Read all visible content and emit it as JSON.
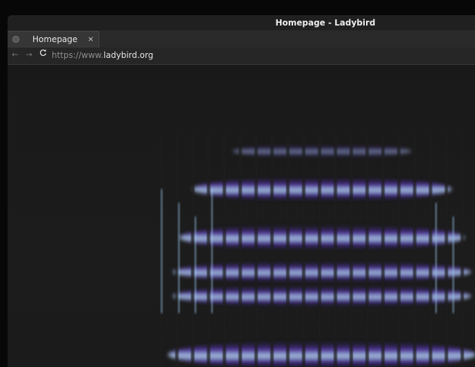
{
  "window": {
    "title": "Homepage - Ladybird"
  },
  "tab": {
    "title": "Homepage",
    "close_glyph": "×",
    "favicon": "ladybird-icon"
  },
  "nav": {
    "back_glyph": "←",
    "forward_glyph": "→",
    "reload_glyph": "C",
    "url_scheme": "https://www.",
    "url_host": "ladybird.org"
  },
  "content": {
    "description_colors": {
      "base": "#1b1b1b",
      "violet": "#4a2e9c",
      "light": "#a9d2f2"
    }
  }
}
